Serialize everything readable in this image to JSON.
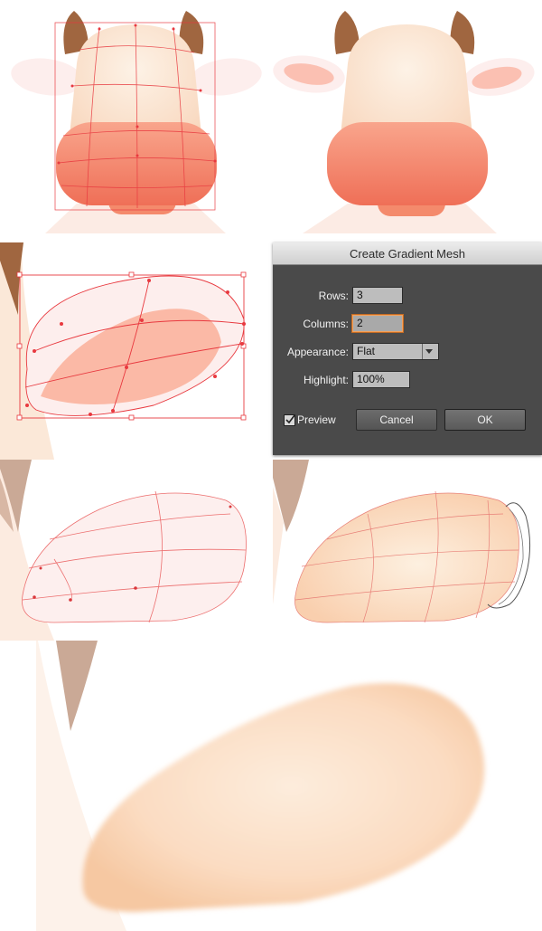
{
  "dialog": {
    "title": "Create Gradient Mesh",
    "rows_label": "Rows:",
    "rows_value": "3",
    "columns_label": "Columns:",
    "columns_value": "2",
    "appearance_label": "Appearance:",
    "appearance_value": "Flat",
    "highlight_label": "Highlight:",
    "highlight_value": "100%",
    "preview_label": "Preview",
    "preview_checked": true,
    "cancel_label": "Cancel",
    "ok_label": "OK",
    "icons": {
      "check": "checkmark-icon",
      "dropdown": "triangle-down-icon"
    }
  },
  "colors": {
    "ear_brown": "#a06640",
    "ear_faded": "#cbaea0",
    "snout_coral": "#f58e72",
    "face_cream": "#fbe4cf",
    "ear_pink": "#fbd2c8",
    "mesh_red": "#e8393f",
    "dialog_bg": "#4a4a4a",
    "focus_orange": "#f4a15a"
  }
}
